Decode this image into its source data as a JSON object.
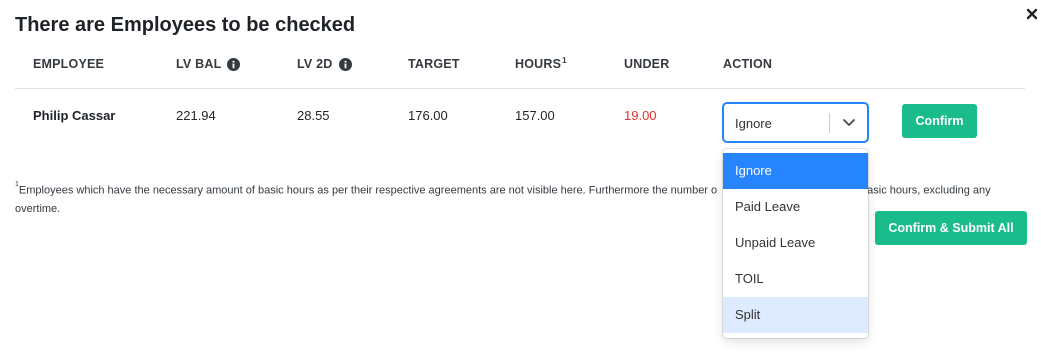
{
  "modal": {
    "title": "There are Employees to be checked",
    "close_symbol": "×"
  },
  "table": {
    "headers": {
      "employee": "EMPLOYEE",
      "lv_bal": "LV BAL",
      "lv_2d": "LV 2D",
      "target": "TARGET",
      "hours": "HOURS",
      "hours_sup": "1",
      "under": "UNDER",
      "action": "ACTION"
    },
    "row": {
      "employee": "Philip Cassar",
      "lv_bal": "221.94",
      "lv_2d": "28.55",
      "target": "176.00",
      "hours": "157.00",
      "under": "19.00",
      "action_value": "Ignore",
      "confirm_label": "Confirm"
    }
  },
  "dropdown": {
    "options": [
      "Ignore",
      "Paid Leave",
      "Unpaid Leave",
      "TOIL",
      "Split"
    ],
    "selected": "Ignore",
    "focused": "Split"
  },
  "footnote": {
    "marker": "1",
    "text": "Employees which have the necessary amount of basic hours as per their respective agreements are not visible here. Furthermore the number o",
    "text_tail": "asic hours, excluding any",
    "text_line2": "overtime."
  },
  "submit_all_label": "Confirm & Submit All",
  "colors": {
    "accent": "#1abc8c",
    "under_red": "#e03131",
    "select_blue": "#2684ff",
    "focus_bg": "#deebff"
  },
  "icons": {
    "info": "info-circle-icon",
    "close": "close-icon",
    "chevron": "chevron-down-icon"
  }
}
